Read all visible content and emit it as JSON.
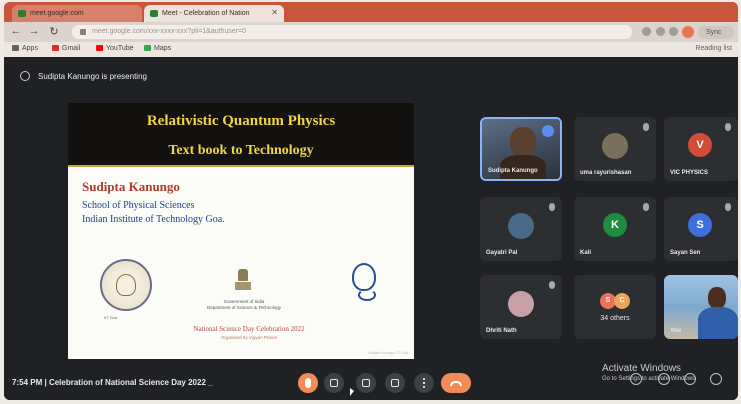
{
  "browser": {
    "tabs": [
      {
        "label": "meet.google.com"
      },
      {
        "label": "Meet - Celebration of Nation"
      }
    ],
    "url": "meet.google.com/xxx-xxxx-xxx?pli=1&authuser=0",
    "sync_label": "Sync",
    "bookmarks": [
      {
        "label": "Apps",
        "color": "#5f6368"
      },
      {
        "label": "Gmail",
        "color": "#d93025"
      },
      {
        "label": "YouTube",
        "color": "#ff0000"
      },
      {
        "label": "Maps",
        "color": "#34a853"
      }
    ],
    "bookmarks_right": "Reading list"
  },
  "meet": {
    "presenting_banner": "Sudipta Kanungo is presenting",
    "slide": {
      "title": "Relativistic Quantum Physics",
      "subtitle": "Text book to Technology",
      "speaker": "Sudipta  Kanungo",
      "school": "School of Physical Sciences",
      "institute": "Indian  Institute  of Technology Goa.",
      "iit_caption": "IIT Goa",
      "govt_line1": "Government of India",
      "govt_line2": "Department of Science & Technology",
      "celebration": "National Science Day Celebration 2022",
      "organized": "Organised by Vigyan Prasar",
      "footer": "Sudipta Kanungo, IIT Goa"
    },
    "participants": [
      {
        "name": "Sudipta Kanungo",
        "type": "video",
        "speaking": true
      },
      {
        "name": "uma rayurishasan",
        "type": "photo",
        "photo_color": "#7a6f5a"
      },
      {
        "name": "VIC PHYSICS",
        "type": "avatar",
        "initial": "V",
        "color": "#d14d36"
      },
      {
        "name": "Gayatri Pal",
        "type": "photo",
        "photo_color": "#4a6a8a"
      },
      {
        "name": "Kali",
        "type": "avatar",
        "initial": "K",
        "color": "#1e8e3e"
      },
      {
        "name": "Sayan Sen",
        "type": "avatar",
        "initial": "S",
        "color": "#3c6fd8"
      },
      {
        "name": "Dhriti Nath",
        "type": "photo",
        "photo_color": "#c9a0a8"
      },
      {
        "name": "34 others",
        "type": "others",
        "initials": [
          "S",
          "C"
        ],
        "colors": [
          "#e8735a",
          "#f0a35a"
        ]
      },
      {
        "name": "You",
        "type": "self"
      }
    ],
    "bottom_bar": {
      "time": "7:54 PM",
      "separator": "|",
      "meeting_title": "Celebration of National Science Day 2022 _"
    },
    "controls": [
      "mic-off-icon",
      "camera-icon",
      "captions-icon",
      "present-icon",
      "more-options-icon",
      "end-call-icon"
    ],
    "windows_watermark": {
      "line1": "Activate Windows",
      "line2": "Go to Settings to activate Windows."
    },
    "accent": "#8ab4f8",
    "end_call_color": "#f28b55"
  }
}
